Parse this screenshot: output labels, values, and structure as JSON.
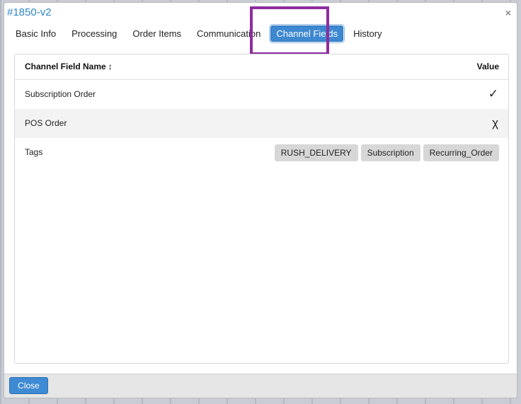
{
  "modal": {
    "title": "#1850-v2",
    "close_icon": "×"
  },
  "tabs": [
    {
      "label": "Basic Info",
      "active": false
    },
    {
      "label": "Processing",
      "active": false
    },
    {
      "label": "Order Items",
      "active": false
    },
    {
      "label": "Communication",
      "active": false
    },
    {
      "label": "Channel Fields",
      "active": true
    },
    {
      "label": "History",
      "active": false
    }
  ],
  "table": {
    "col_name": "Channel Field Name",
    "sort_icon": "↕",
    "col_value": "Value",
    "rows": [
      {
        "name": "Subscription Order",
        "value_icon": "✓",
        "icon_name": "check-icon"
      },
      {
        "name": "POS Order",
        "value_icon": "χ",
        "icon_name": "cross-icon"
      },
      {
        "name": "Tags",
        "tags": [
          "RUSH_DELIVERY",
          "Subscription",
          "Recurring_Order"
        ]
      }
    ]
  },
  "footer": {
    "close_label": "Close"
  },
  "colors": {
    "accent": "#3d88d1",
    "highlight": "#8e2d9f",
    "title": "#2f86c6"
  }
}
